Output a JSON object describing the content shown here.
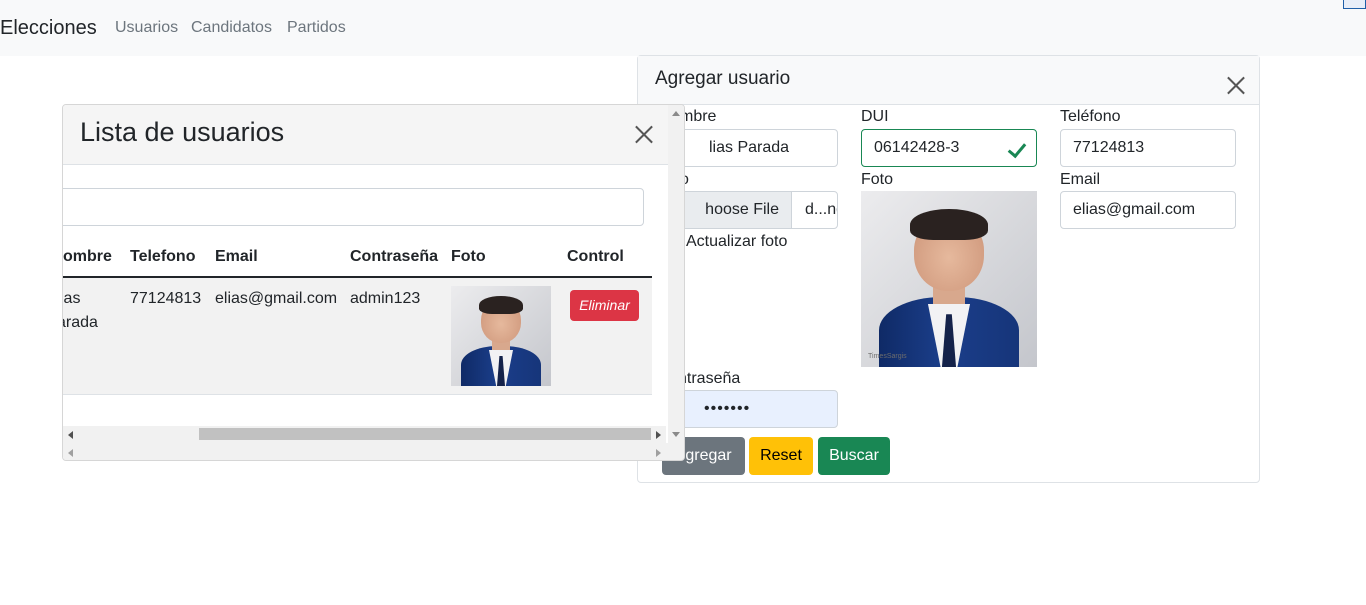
{
  "navbar": {
    "brand": "Elecciones",
    "links": [
      "Usuarios",
      "Candidatos",
      "Partidos"
    ]
  },
  "agregar": {
    "title": "Agregar usuario",
    "labels": {
      "nombre": "mbre",
      "dui": "DUI",
      "telefono": "Teléfono",
      "foto_input": "o",
      "foto": "Foto",
      "email": "Email",
      "contrasena": "ntraseña",
      "actualizar_foto": "Actualizar foto"
    },
    "values": {
      "nombre": "lias Parada",
      "dui": "06142428-3",
      "telefono": "77124813",
      "email": "elias@gmail.com",
      "contrasena": "•••••••",
      "file_button": "hoose File",
      "file_name": "d...ng"
    },
    "buttons": {
      "agregar": "gregar",
      "reset": "Reset",
      "buscar": "Buscar"
    }
  },
  "lista": {
    "title": "Lista de usuarios",
    "search_value": "",
    "columns": [
      "ombre",
      "Telefono",
      "Email",
      "Contraseña",
      "Foto",
      "Control"
    ],
    "rows": [
      {
        "nombre_line1": "ias",
        "nombre_line2": "arada",
        "telefono": "77124813",
        "email": "elias@gmail.com",
        "contrasena": "admin123",
        "control": "Eliminar"
      }
    ]
  },
  "photo_watermark": "TimesSargis",
  "colors": {
    "navbar_bg": "#f8f9fa",
    "success": "#198754",
    "warning": "#ffc107",
    "danger": "#dc3545",
    "secondary": "#6c757d"
  }
}
